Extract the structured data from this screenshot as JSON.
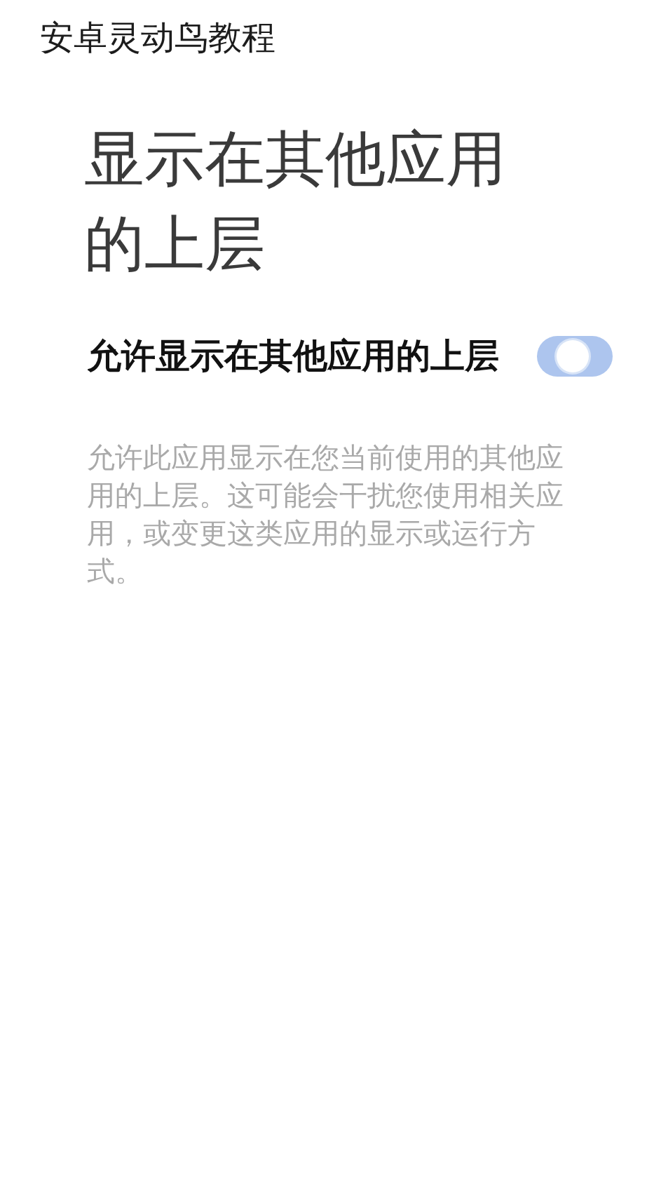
{
  "caption": "安卓灵动鸟教程",
  "page": {
    "title": "显示在其他应用的上层"
  },
  "setting": {
    "label": "允许显示在其他应用的上层",
    "on": true
  },
  "description": "允许此应用显示在您当前使用的其他应用的上层。这可能会干扰您使用相关应用，或变更这类应用的显示或运行方式。"
}
